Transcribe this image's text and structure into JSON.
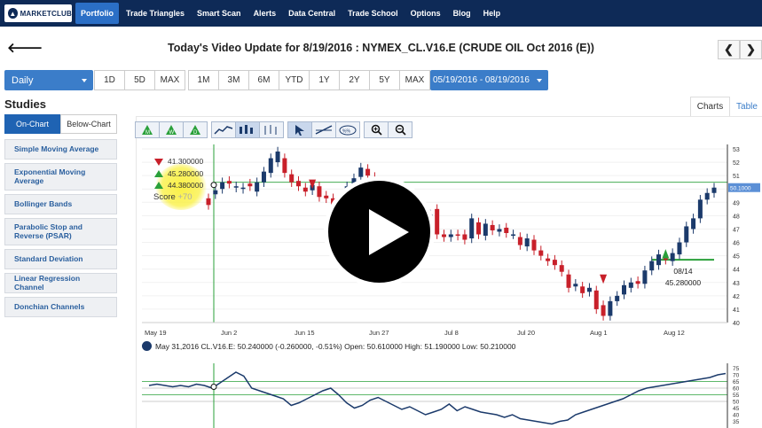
{
  "nav": {
    "logo": "MARKETCLUB",
    "items": [
      {
        "label": "Portfolio",
        "active": true
      },
      {
        "label": "Trade Triangles",
        "active": false
      },
      {
        "label": "Smart Scan",
        "active": false
      },
      {
        "label": "Alerts",
        "active": false
      },
      {
        "label": "Data Central",
        "active": false
      },
      {
        "label": "Trade School",
        "active": false
      },
      {
        "label": "Options",
        "active": false
      },
      {
        "label": "Blog",
        "active": false
      },
      {
        "label": "Help",
        "active": false
      }
    ]
  },
  "header": {
    "title": "Today's Video Update for 8/19/2016 : NYMEX_CL.V16.E (CRUDE OIL Oct 2016 (E))",
    "prev": "❮",
    "next": "❯"
  },
  "toolbar": {
    "interval": "Daily",
    "ranges_a": [
      "1D",
      "5D",
      "MAX"
    ],
    "ranges_b": [
      "1M",
      "3M",
      "6M",
      "YTD",
      "1Y",
      "2Y",
      "5Y",
      "MAX"
    ],
    "date_range": "05/19/2016 - 08/19/2016"
  },
  "studies": {
    "heading": "Studies",
    "tabs": [
      "On-Chart",
      "Below-Chart"
    ],
    "items": [
      "Simple Moving Average",
      "Exponential Moving Average",
      "Bollinger Bands",
      "Parabolic Stop and Reverse (PSAR)",
      "Standard Deviation",
      "Linear Regression Channel",
      "Donchian Channels"
    ]
  },
  "chart_tabs": [
    "Charts",
    "Table"
  ],
  "chart_overlay": {
    "prices": [
      "41.300000",
      "45.280000",
      "44.380000"
    ],
    "score_label": "Score",
    "score_value": "+70",
    "tooltip_date": "08/14",
    "tooltip_price": "45.280000",
    "last_price": "50.1000"
  },
  "readout": "May 31,2016 CL.V16.E: 50.240000 (-0.260000, -0.51%) Open: 50.610000 High: 51.190000 Low: 50.210000",
  "chart_data": [
    {
      "type": "candlestick",
      "x_ticks": [
        "May 19",
        "Jun 2",
        "Jun 15",
        "Jun 27",
        "Jul 8",
        "Jul 20",
        "Aug 1",
        "Aug 12"
      ],
      "y_ticks": [
        53,
        52,
        51,
        50,
        49,
        48,
        47,
        46,
        45,
        44,
        43,
        42,
        41,
        40
      ],
      "ylim": [
        40,
        53
      ],
      "colors": {
        "up": "#1b3a6b",
        "down": "#c8202a",
        "support": "#2aa03a"
      },
      "candles": [
        {
          "o": 49.3,
          "c": 48.8
        },
        {
          "o": 49.6,
          "c": 49.9
        },
        {
          "o": 50.0,
          "c": 50.5
        },
        {
          "o": 50.6,
          "c": 50.4
        },
        {
          "o": 50.1,
          "c": 50.2
        },
        {
          "o": 50.0,
          "c": 50.1
        },
        {
          "o": 50.4,
          "c": 50.2
        },
        {
          "o": 49.8,
          "c": 50.5
        },
        {
          "o": 50.5,
          "c": 51.3
        },
        {
          "o": 51.2,
          "c": 52.3
        },
        {
          "o": 52.0,
          "c": 52.8
        },
        {
          "o": 52.3,
          "c": 51.2
        },
        {
          "o": 51.1,
          "c": 50.5
        },
        {
          "o": 50.6,
          "c": 50.2
        },
        {
          "o": 50.1,
          "c": 49.8
        },
        {
          "o": 49.9,
          "c": 50.3
        },
        {
          "o": 50.2,
          "c": 49.4
        },
        {
          "o": 49.5,
          "c": 49.3
        },
        {
          "o": 49.3,
          "c": 48.3
        },
        {
          "o": 48.2,
          "c": 49.3
        },
        {
          "o": 49.2,
          "c": 50.2
        },
        {
          "o": 50.2,
          "c": 50.8
        },
        {
          "o": 50.9,
          "c": 51.6
        },
        {
          "o": 51.5,
          "c": 51.0
        },
        {
          "o": 50.9,
          "c": 49.7
        },
        {
          "o": 49.6,
          "c": 48.8
        },
        {
          "o": 48.5,
          "c": 47.8
        },
        {
          "o": 47.6,
          "c": 48.0
        },
        {
          "o": 48.0,
          "c": 48.6
        },
        {
          "o": 48.7,
          "c": 49.0
        },
        {
          "o": 49.0,
          "c": 48.3
        },
        {
          "o": 48.3,
          "c": 47.8
        },
        {
          "o": 47.6,
          "c": 48.1
        },
        {
          "o": 48.5,
          "c": 46.6
        },
        {
          "o": 46.6,
          "c": 46.4
        },
        {
          "o": 46.4,
          "c": 46.6
        },
        {
          "o": 46.6,
          "c": 46.5
        },
        {
          "o": 46.6,
          "c": 46.2
        },
        {
          "o": 46.3,
          "c": 47.8
        },
        {
          "o": 47.5,
          "c": 46.6
        },
        {
          "o": 46.5,
          "c": 47.4
        },
        {
          "o": 47.3,
          "c": 46.9
        },
        {
          "o": 46.8,
          "c": 47.0
        },
        {
          "o": 47.1,
          "c": 46.7
        },
        {
          "o": 46.6,
          "c": 46.6
        },
        {
          "o": 46.4,
          "c": 45.8
        },
        {
          "o": 45.7,
          "c": 46.3
        },
        {
          "o": 46.2,
          "c": 45.4
        },
        {
          "o": 45.4,
          "c": 45.0
        },
        {
          "o": 44.8,
          "c": 44.6
        },
        {
          "o": 44.7,
          "c": 44.3
        },
        {
          "o": 44.3,
          "c": 43.8
        },
        {
          "o": 43.6,
          "c": 42.6
        },
        {
          "o": 42.7,
          "c": 42.9
        },
        {
          "o": 42.7,
          "c": 42.2
        },
        {
          "o": 42.3,
          "c": 42.6
        },
        {
          "o": 42.4,
          "c": 41.0
        },
        {
          "o": 41.3,
          "c": 40.5
        },
        {
          "o": 40.5,
          "c": 41.6
        },
        {
          "o": 41.6,
          "c": 42.0
        },
        {
          "o": 42.1,
          "c": 42.8
        },
        {
          "o": 42.6,
          "c": 43.0
        },
        {
          "o": 43.1,
          "c": 42.9
        },
        {
          "o": 42.9,
          "c": 43.9
        },
        {
          "o": 43.9,
          "c": 44.6
        },
        {
          "o": 44.3,
          "c": 45.1
        },
        {
          "o": 45.0,
          "c": 44.7
        },
        {
          "o": 44.6,
          "c": 45.2
        },
        {
          "o": 45.1,
          "c": 46.0
        },
        {
          "o": 46.0,
          "c": 47.2
        },
        {
          "o": 47.0,
          "c": 47.8
        },
        {
          "o": 47.8,
          "c": 49.2
        },
        {
          "o": 49.2,
          "c": 49.7
        },
        {
          "o": 49.7,
          "c": 50.1
        }
      ],
      "support_level": 50.5,
      "support_level_2": 44.7
    },
    {
      "type": "line",
      "y_ticks": [
        75,
        70,
        65,
        60,
        55,
        50,
        45,
        40,
        35
      ],
      "ylim": [
        32,
        76
      ],
      "values": [
        62,
        63,
        62,
        61,
        62,
        61,
        63,
        62,
        60,
        64,
        68,
        72,
        69,
        60,
        58,
        56,
        54,
        52,
        47,
        49,
        52,
        55,
        58,
        60,
        55,
        49,
        45,
        47,
        51,
        53,
        50,
        47,
        44,
        46,
        43,
        40,
        42,
        44,
        48,
        43,
        46,
        44,
        42,
        41,
        40,
        38,
        40,
        37,
        36,
        35,
        34,
        33,
        35,
        36,
        40,
        42,
        44,
        46,
        48,
        50,
        52,
        55,
        58,
        60,
        61,
        62,
        63,
        64,
        65,
        66,
        67,
        68,
        70,
        71
      ],
      "reference_levels": [
        65,
        60,
        55,
        50
      ]
    }
  ]
}
